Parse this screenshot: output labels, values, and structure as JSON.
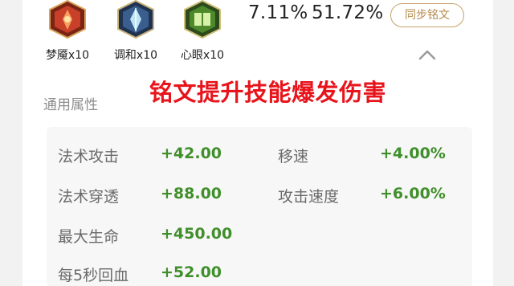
{
  "runes": [
    {
      "name": "梦魇x10",
      "icon": "red-rune-icon",
      "color": "#c8402a"
    },
    {
      "name": "调和x10",
      "icon": "blue-rune-icon",
      "color": "#3a5f8f"
    },
    {
      "name": "心眼x10",
      "icon": "green-rune-icon",
      "color": "#4e8a2c"
    }
  ],
  "stats": {
    "pct1": "7.11%",
    "pct2": "51.72%"
  },
  "sync_button": "同步铭文",
  "collapse_icon": "chevron-up-icon",
  "overlay_text": "铭文提升技能爆发伤害",
  "section_title": "通用属性",
  "attributes": [
    {
      "label": "法术攻击",
      "value": "+42.00"
    },
    {
      "label": "移速",
      "value": "+4.00%"
    },
    {
      "label": "法术穿透",
      "value": "+88.00"
    },
    {
      "label": "攻击速度",
      "value": "+6.00%"
    },
    {
      "label": "最大生命",
      "value": "+450.00"
    },
    {
      "label": "每5秒回血",
      "value": "+52.00"
    }
  ],
  "colors": {
    "accent": "#c7a26a",
    "value_green": "#3f8f2a",
    "overlay_red": "#e8141c"
  }
}
